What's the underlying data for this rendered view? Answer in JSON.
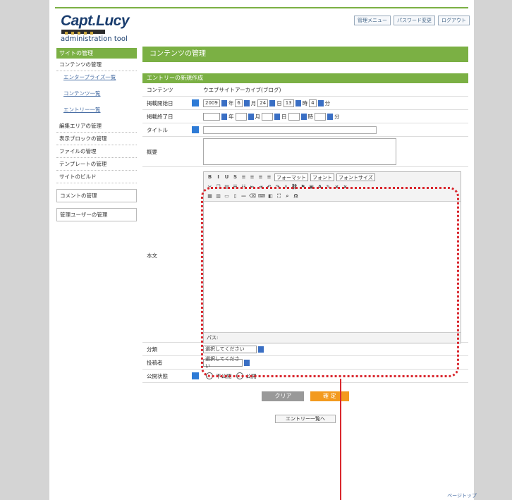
{
  "logo": {
    "title": "Capt.Lucy",
    "subtitle": "administration tool"
  },
  "topnav": [
    "管理メニュー",
    "パスワード変更",
    "ログアウト"
  ],
  "sidebar": {
    "head": "サイトの管理",
    "items": [
      {
        "label": "コンテンツの管理"
      },
      {
        "label": "エンタープライズ一覧"
      },
      {
        "label": "コンテンツ一覧"
      },
      {
        "label": "エントリー一覧"
      },
      {
        "label": "編集エリアの管理"
      },
      {
        "label": "表示ブロックの管理"
      },
      {
        "label": "ファイルの管理"
      },
      {
        "label": "テンプレートの管理"
      },
      {
        "label": "サイトのビルド"
      },
      {
        "label": "コメントの管理"
      },
      {
        "label": "管理ユーザーの管理"
      }
    ]
  },
  "main": {
    "title": "コンテンツの管理",
    "section": "エントリーの新規作成",
    "form": {
      "content_label": "コンテンツ",
      "content_value": "ウエブサイトアーカイブ(ブログ)",
      "start_label": "掲載開始日",
      "start_year": "2009",
      "start_month": "6",
      "start_day": "24",
      "start_hour": "13",
      "start_min": "4",
      "end_label": "掲載終了日",
      "title_label": "タイトル",
      "summary_label": "概要",
      "body_label": "本文",
      "format_label": "フォーマット",
      "font_label": "フォント",
      "size_label": "フォントサイズ",
      "path_label": "パス:",
      "category_label": "分類",
      "category_value": "選択してください",
      "author_label": "投稿者",
      "author_value": "選択してください",
      "status_label": "公開状態",
      "status_private": "不公開",
      "status_public": "公開",
      "clear_button": "クリア",
      "submit_button": "確 定",
      "list_link": "エントリー一覧へ"
    },
    "unit_year": "年",
    "unit_month": "月",
    "unit_day": "日",
    "unit_hour": "時",
    "unit_min": "分"
  },
  "footer": {
    "pagetop": "ページトップ"
  },
  "colors": {
    "accent": "#7bb044",
    "highlight": "#d9272e",
    "submit": "#f39a1e"
  }
}
